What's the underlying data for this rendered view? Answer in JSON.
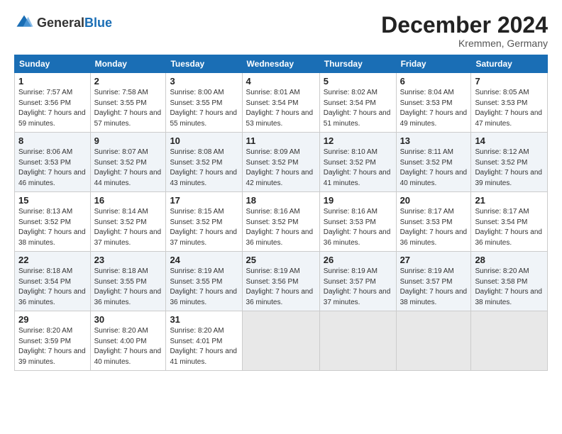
{
  "header": {
    "logo_general": "General",
    "logo_blue": "Blue",
    "month_title": "December 2024",
    "location": "Kremmen, Germany"
  },
  "days_of_week": [
    "Sunday",
    "Monday",
    "Tuesday",
    "Wednesday",
    "Thursday",
    "Friday",
    "Saturday"
  ],
  "weeks": [
    [
      {
        "day": "1",
        "sunrise": "7:57 AM",
        "sunset": "3:56 PM",
        "daylight": "7 hours and 59 minutes."
      },
      {
        "day": "2",
        "sunrise": "7:58 AM",
        "sunset": "3:55 PM",
        "daylight": "7 hours and 57 minutes."
      },
      {
        "day": "3",
        "sunrise": "8:00 AM",
        "sunset": "3:55 PM",
        "daylight": "7 hours and 55 minutes."
      },
      {
        "day": "4",
        "sunrise": "8:01 AM",
        "sunset": "3:54 PM",
        "daylight": "7 hours and 53 minutes."
      },
      {
        "day": "5",
        "sunrise": "8:02 AM",
        "sunset": "3:54 PM",
        "daylight": "7 hours and 51 minutes."
      },
      {
        "day": "6",
        "sunrise": "8:04 AM",
        "sunset": "3:53 PM",
        "daylight": "7 hours and 49 minutes."
      },
      {
        "day": "7",
        "sunrise": "8:05 AM",
        "sunset": "3:53 PM",
        "daylight": "7 hours and 47 minutes."
      }
    ],
    [
      {
        "day": "8",
        "sunrise": "8:06 AM",
        "sunset": "3:53 PM",
        "daylight": "7 hours and 46 minutes."
      },
      {
        "day": "9",
        "sunrise": "8:07 AM",
        "sunset": "3:52 PM",
        "daylight": "7 hours and 44 minutes."
      },
      {
        "day": "10",
        "sunrise": "8:08 AM",
        "sunset": "3:52 PM",
        "daylight": "7 hours and 43 minutes."
      },
      {
        "day": "11",
        "sunrise": "8:09 AM",
        "sunset": "3:52 PM",
        "daylight": "7 hours and 42 minutes."
      },
      {
        "day": "12",
        "sunrise": "8:10 AM",
        "sunset": "3:52 PM",
        "daylight": "7 hours and 41 minutes."
      },
      {
        "day": "13",
        "sunrise": "8:11 AM",
        "sunset": "3:52 PM",
        "daylight": "7 hours and 40 minutes."
      },
      {
        "day": "14",
        "sunrise": "8:12 AM",
        "sunset": "3:52 PM",
        "daylight": "7 hours and 39 minutes."
      }
    ],
    [
      {
        "day": "15",
        "sunrise": "8:13 AM",
        "sunset": "3:52 PM",
        "daylight": "7 hours and 38 minutes."
      },
      {
        "day": "16",
        "sunrise": "8:14 AM",
        "sunset": "3:52 PM",
        "daylight": "7 hours and 37 minutes."
      },
      {
        "day": "17",
        "sunrise": "8:15 AM",
        "sunset": "3:52 PM",
        "daylight": "7 hours and 37 minutes."
      },
      {
        "day": "18",
        "sunrise": "8:16 AM",
        "sunset": "3:52 PM",
        "daylight": "7 hours and 36 minutes."
      },
      {
        "day": "19",
        "sunrise": "8:16 AM",
        "sunset": "3:53 PM",
        "daylight": "7 hours and 36 minutes."
      },
      {
        "day": "20",
        "sunrise": "8:17 AM",
        "sunset": "3:53 PM",
        "daylight": "7 hours and 36 minutes."
      },
      {
        "day": "21",
        "sunrise": "8:17 AM",
        "sunset": "3:54 PM",
        "daylight": "7 hours and 36 minutes."
      }
    ],
    [
      {
        "day": "22",
        "sunrise": "8:18 AM",
        "sunset": "3:54 PM",
        "daylight": "7 hours and 36 minutes."
      },
      {
        "day": "23",
        "sunrise": "8:18 AM",
        "sunset": "3:55 PM",
        "daylight": "7 hours and 36 minutes."
      },
      {
        "day": "24",
        "sunrise": "8:19 AM",
        "sunset": "3:55 PM",
        "daylight": "7 hours and 36 minutes."
      },
      {
        "day": "25",
        "sunrise": "8:19 AM",
        "sunset": "3:56 PM",
        "daylight": "7 hours and 36 minutes."
      },
      {
        "day": "26",
        "sunrise": "8:19 AM",
        "sunset": "3:57 PM",
        "daylight": "7 hours and 37 minutes."
      },
      {
        "day": "27",
        "sunrise": "8:19 AM",
        "sunset": "3:57 PM",
        "daylight": "7 hours and 38 minutes."
      },
      {
        "day": "28",
        "sunrise": "8:20 AM",
        "sunset": "3:58 PM",
        "daylight": "7 hours and 38 minutes."
      }
    ],
    [
      {
        "day": "29",
        "sunrise": "8:20 AM",
        "sunset": "3:59 PM",
        "daylight": "7 hours and 39 minutes."
      },
      {
        "day": "30",
        "sunrise": "8:20 AM",
        "sunset": "4:00 PM",
        "daylight": "7 hours and 40 minutes."
      },
      {
        "day": "31",
        "sunrise": "8:20 AM",
        "sunset": "4:01 PM",
        "daylight": "7 hours and 41 minutes."
      },
      null,
      null,
      null,
      null
    ]
  ],
  "labels": {
    "sunrise": "Sunrise:",
    "sunset": "Sunset:",
    "daylight": "Daylight:"
  }
}
